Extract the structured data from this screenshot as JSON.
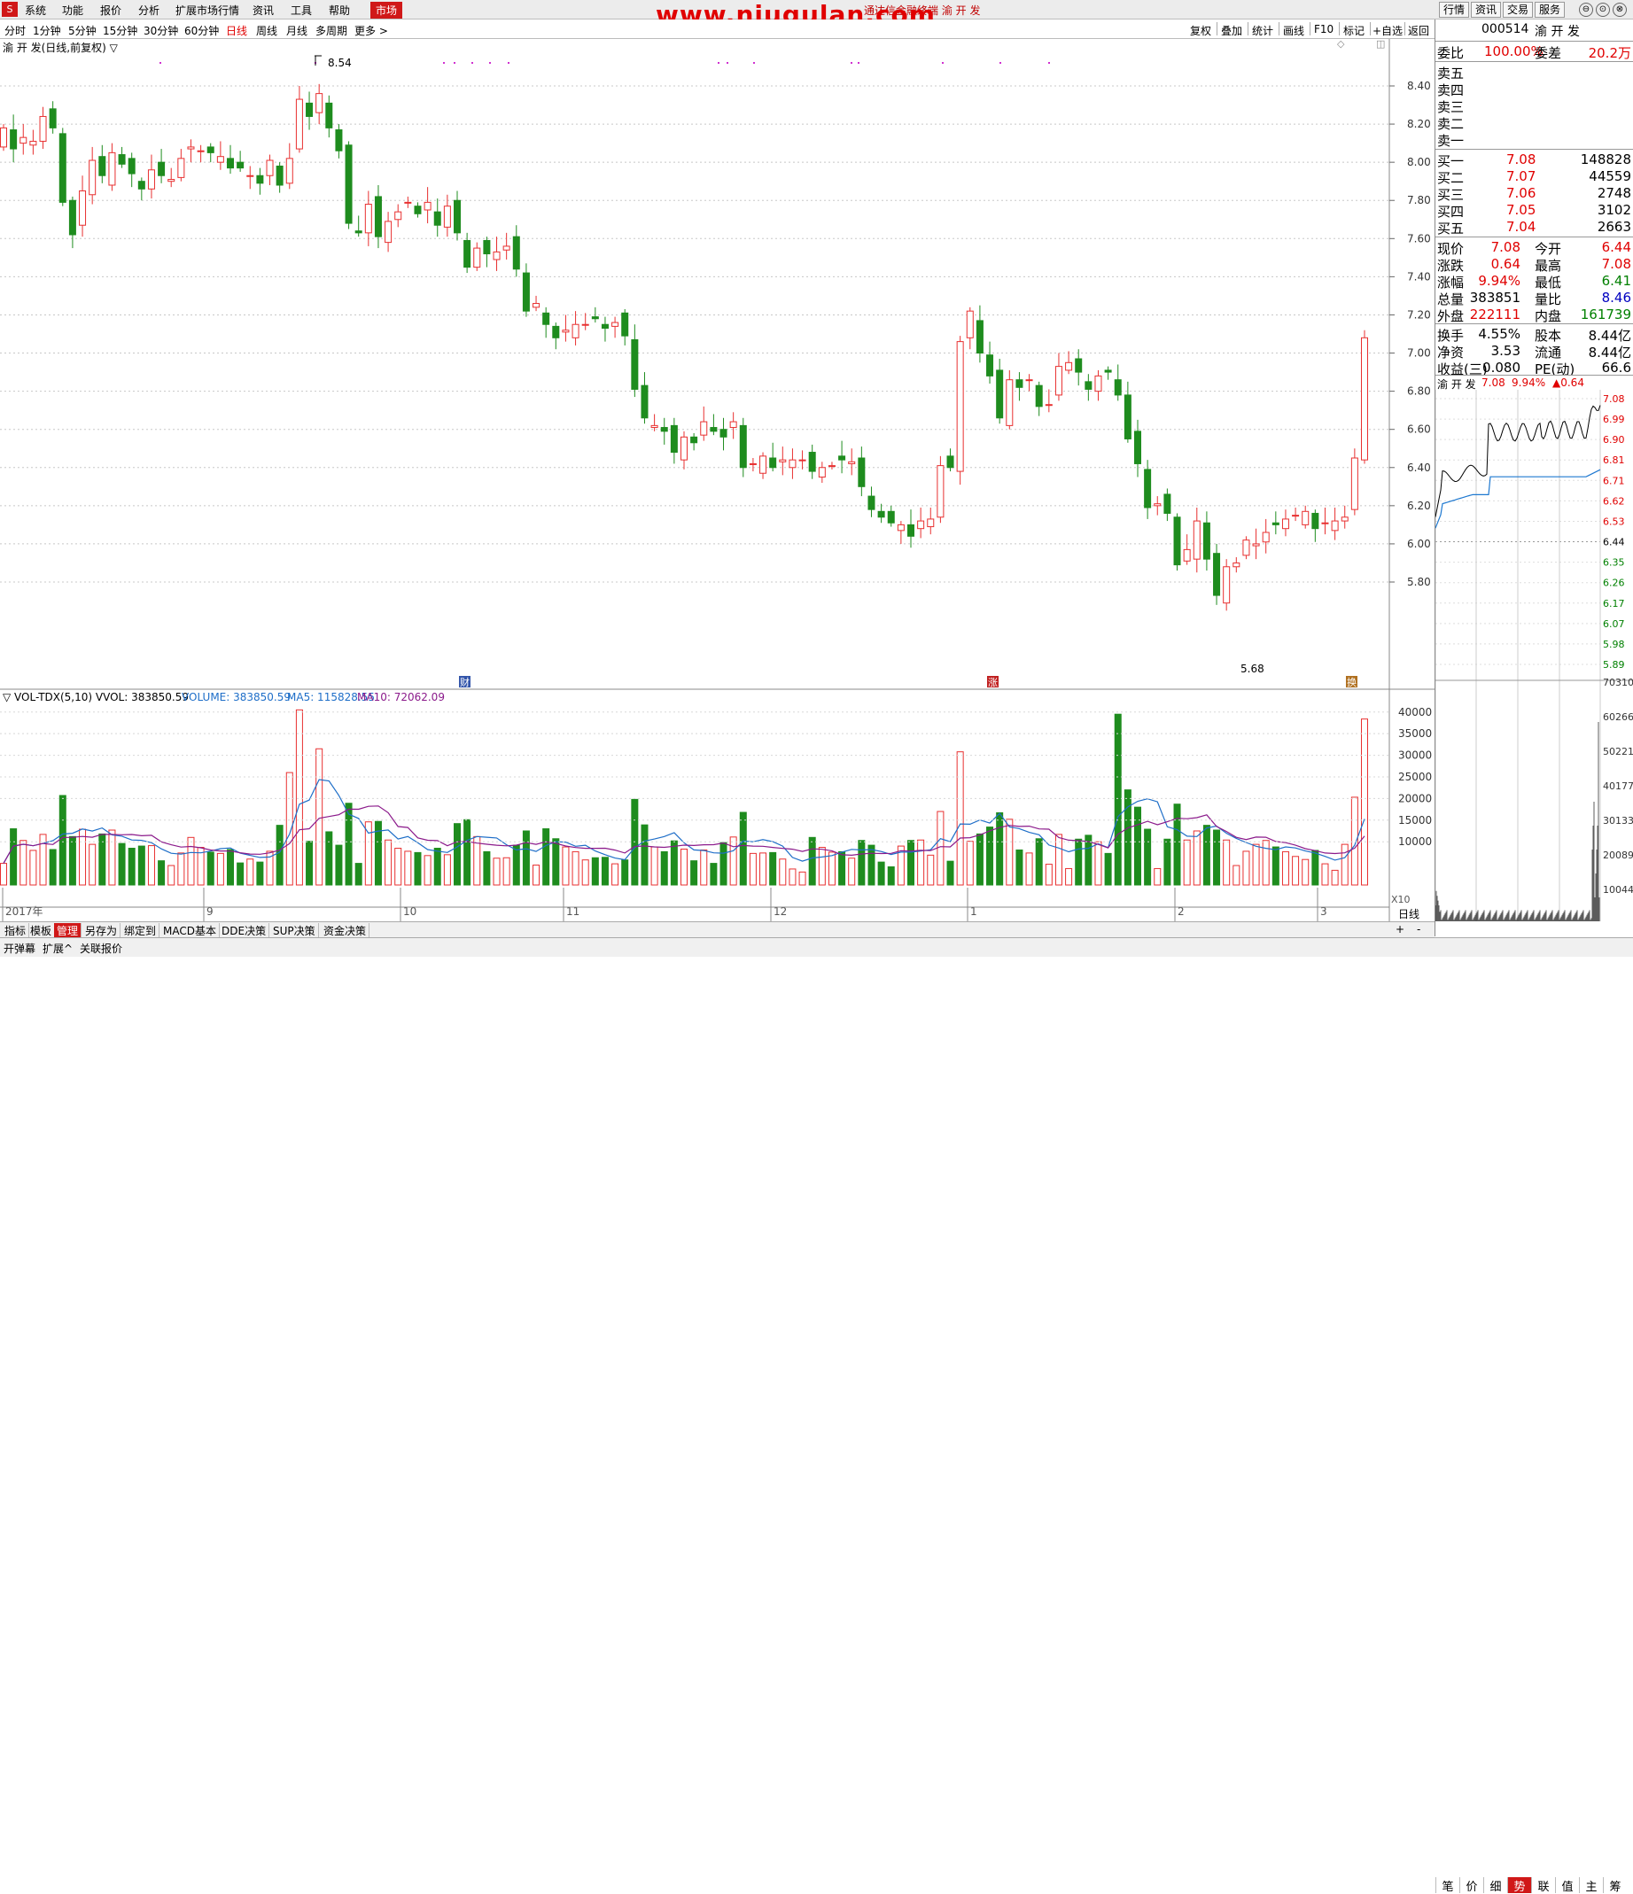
{
  "menu": {
    "logo": "S",
    "items": [
      "系统",
      "功能",
      "报价",
      "分析",
      "扩展市场行情",
      "资讯",
      "工具",
      "帮助"
    ],
    "market": "市场",
    "title_center": "通达信金融终端 渝 开 发",
    "watermark": "www.niugulan.com",
    "right_buttons": [
      "行情",
      "资讯",
      "交易",
      "服务"
    ],
    "window_icons": [
      "⊖",
      "⊙",
      "⊗"
    ]
  },
  "period_bar": {
    "items": [
      "分时",
      "1分钟",
      "5分钟",
      "15分钟",
      "30分钟",
      "60分钟",
      "日线",
      "周线",
      "月线",
      "多周期",
      "更多"
    ],
    "active_index": 6
  },
  "toolbar": {
    "items": [
      "复权",
      "叠加",
      "统计",
      "画线",
      "F10",
      "标记",
      "+自选",
      "返回"
    ]
  },
  "main_chart": {
    "title": "渝 开 发(日线,前复权) ▽",
    "high_label": "8.54",
    "low_label": "5.68",
    "y_ticks": [
      "8.40",
      "8.20",
      "8.00",
      "7.80",
      "7.60",
      "7.40",
      "7.20",
      "7.00",
      "6.80",
      "6.60",
      "6.40",
      "6.20",
      "6.00",
      "5.80"
    ],
    "markers": [
      "财",
      "涨",
      "换"
    ],
    "month_labels": [
      "2017年",
      "9",
      "10",
      "11",
      "12",
      "1",
      "2",
      "3"
    ]
  },
  "volume_chart": {
    "title_prefix": "▽ VOL-TDX(5,10) VVOL: 383850.59",
    "volume_label": "VOLUME: 383850.59",
    "ma5_label": "MA5: 115828.55",
    "ma10_label": "MA10: 72062.09",
    "y_ticks": [
      "40000",
      "35000",
      "30000",
      "25000",
      "20000",
      "15000",
      "10000"
    ],
    "scale_label": "X10"
  },
  "chart_data": {
    "type": "candlestick",
    "ylim": [
      5.6,
      8.6
    ],
    "ohlc_bars": 147,
    "volume_ylim": [
      0,
      42000
    ]
  },
  "quote_panel": {
    "code": "000514",
    "name": "渝 开 发",
    "weibi_label": "委比",
    "weibi": "100.00%",
    "weicha_label": "委差",
    "weicha": "20.2万",
    "sell_labels": [
      "卖五",
      "卖四",
      "卖三",
      "卖二",
      "卖一"
    ],
    "buys": [
      {
        "label": "买一",
        "price": "7.08",
        "vol": "148828"
      },
      {
        "label": "买二",
        "price": "7.07",
        "vol": "44559"
      },
      {
        "label": "买三",
        "price": "7.06",
        "vol": "2748"
      },
      {
        "label": "买四",
        "price": "7.05",
        "vol": "3102"
      },
      {
        "label": "买五",
        "price": "7.04",
        "vol": "2663"
      }
    ],
    "stats": [
      {
        "l1": "现价",
        "v1": "7.08",
        "c1": "red",
        "l2": "今开",
        "v2": "6.44",
        "c2": "red"
      },
      {
        "l1": "涨跌",
        "v1": "0.64",
        "c1": "red",
        "l2": "最高",
        "v2": "7.08",
        "c2": "red"
      },
      {
        "l1": "涨幅",
        "v1": "9.94%",
        "c1": "red",
        "l2": "最低",
        "v2": "6.41",
        "c2": "grn"
      },
      {
        "l1": "总量",
        "v1": "383851",
        "c1": "blk",
        "l2": "量比",
        "v2": "8.46",
        "c2": "blu"
      },
      {
        "l1": "外盘",
        "v1": "222111",
        "c1": "red",
        "l2": "内盘",
        "v2": "161739",
        "c2": "grn"
      }
    ],
    "stats2": [
      {
        "l1": "换手",
        "v1": "4.55%",
        "l2": "股本",
        "v2": "8.44亿"
      },
      {
        "l1": "净资",
        "v1": "3.53",
        "l2": "流通",
        "v2": "8.44亿"
      },
      {
        "l1": "收益(三)",
        "v1": "0.080",
        "l2": "PE(动)",
        "v2": "66.6"
      }
    ],
    "mini_title_name": "渝 开 发",
    "mini_title_price": "7.08",
    "mini_title_pct": "9.94%",
    "mini_title_chg": "▲0.64",
    "mini_price_ticks": [
      "7.08",
      "6.99",
      "6.90",
      "6.81",
      "6.71",
      "6.62",
      "6.53",
      "6.44",
      "6.35",
      "6.26",
      "6.17",
      "6.07",
      "5.98",
      "5.89"
    ],
    "mini_vol_ticks": [
      "70310",
      "60266",
      "50221",
      "40177",
      "30133",
      "20089",
      "10044"
    ]
  },
  "bottom_tabs": [
    "指标",
    "模板",
    "管理",
    "另存为",
    "绑定到",
    "MACD基本",
    "DDE决策",
    "SUP决策",
    "资金决策"
  ],
  "bottom_right": [
    "+",
    "-",
    "日线"
  ],
  "status": [
    "开弹幕",
    "扩展^",
    "关联报价"
  ],
  "right_tabs": [
    "笔",
    "价",
    "细",
    "势",
    "联",
    "值",
    "主",
    "筹"
  ]
}
